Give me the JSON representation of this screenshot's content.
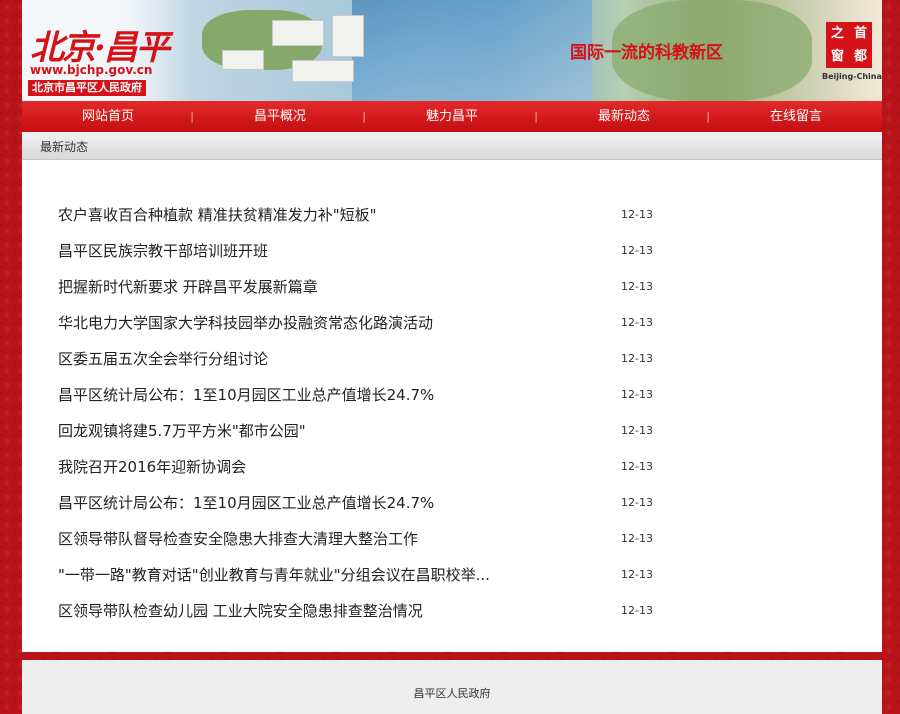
{
  "header": {
    "logo_title": "北京·昌平",
    "logo_url": "www.bjchp.gov.cn",
    "logo_org": "北京市昌平区人民政府",
    "slogan": "国际一流的科教新区",
    "seal_chars": [
      "首",
      "都",
      "之",
      "窗"
    ],
    "seal_caption": "Beijing-China"
  },
  "nav": {
    "items": [
      "网站首页",
      "昌平概况",
      "魅力昌平",
      "最新动态",
      "在线留言"
    ]
  },
  "breadcrumb": "最新动态",
  "news": [
    {
      "title": "农户喜收百合种植款 精准扶贫精准发力补\"短板\"",
      "date": "12-13"
    },
    {
      "title": "昌平区民族宗教干部培训班开班",
      "date": "12-13"
    },
    {
      "title": "把握新时代新要求 开辟昌平发展新篇章",
      "date": "12-13"
    },
    {
      "title": "华北电力大学国家大学科技园举办投融资常态化路演活动",
      "date": "12-13"
    },
    {
      "title": "区委五届五次全会举行分组讨论",
      "date": "12-13"
    },
    {
      "title": "昌平区统计局公布：1至10月园区工业总产值增长24.7%",
      "date": "12-13"
    },
    {
      "title": "回龙观镇将建5.7万平方米\"都市公园\"",
      "date": "12-13"
    },
    {
      "title": "我院召开2016年迎新协调会",
      "date": "12-13"
    },
    {
      "title": "昌平区统计局公布：1至10月园区工业总产值增长24.7%",
      "date": "12-13"
    },
    {
      "title": "区领导带队督导检查安全隐患大排查大清理大整治工作",
      "date": "12-13"
    },
    {
      "title": "\"一带一路\"教育对话\"创业教育与青年就业\"分组会议在昌职校举...",
      "date": "12-13"
    },
    {
      "title": "区领导带队检查幼儿园 工业大院安全隐患排查整治情况",
      "date": "12-13"
    }
  ],
  "footer": "昌平区人民政府"
}
